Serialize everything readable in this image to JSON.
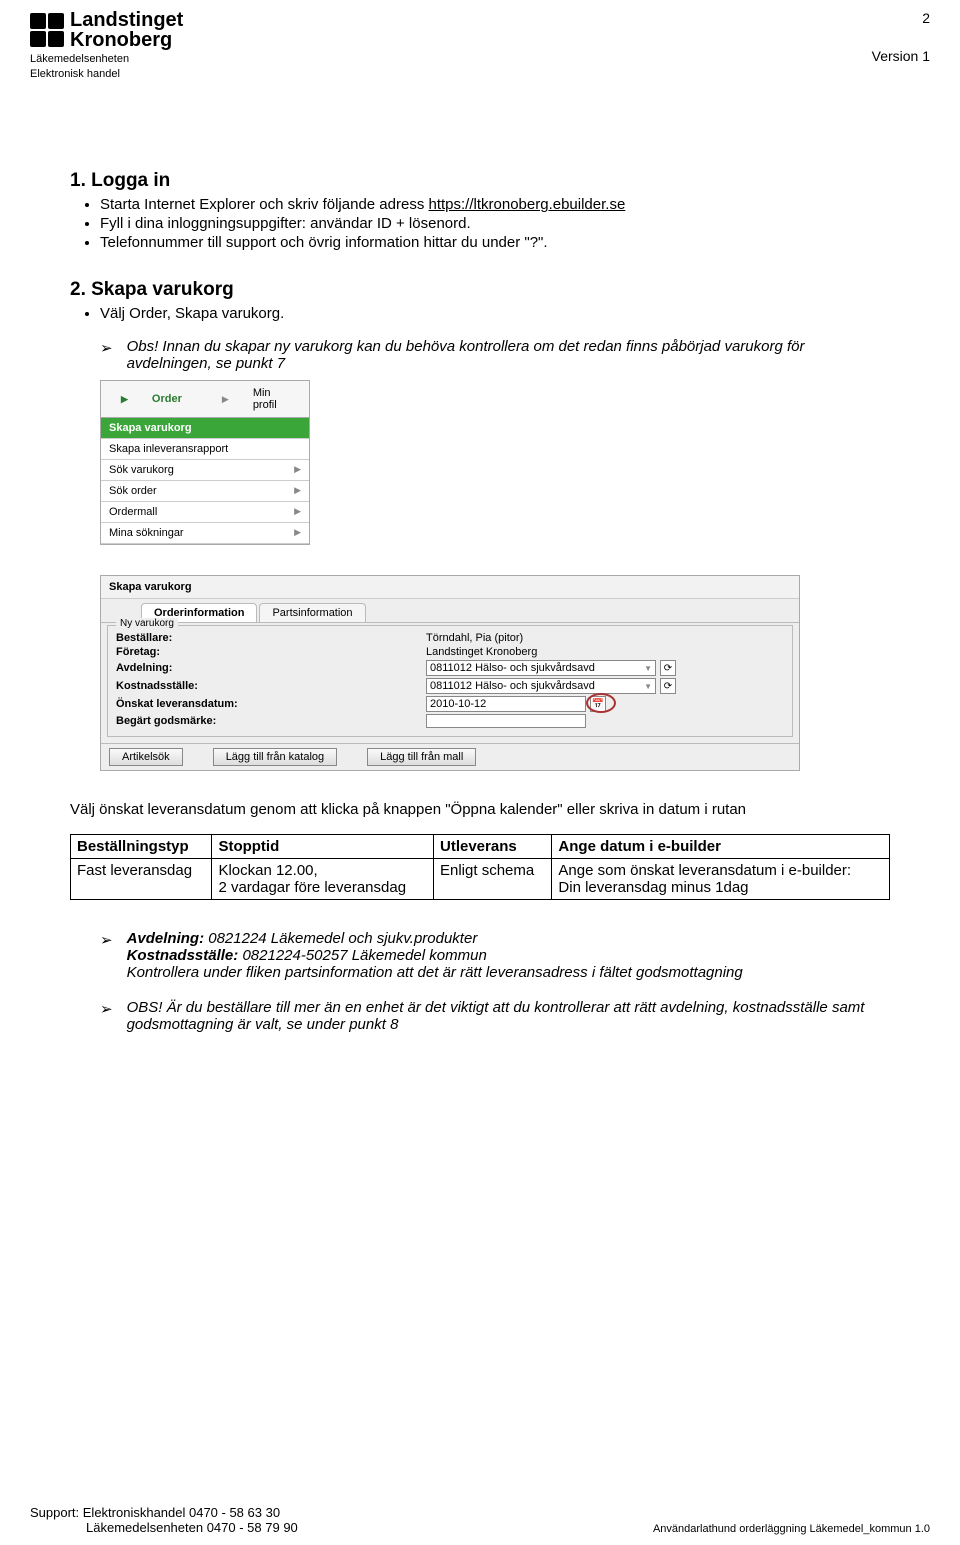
{
  "header": {
    "logo_line1": "Landstinget",
    "logo_line2": "Kronoberg",
    "sub1": "Läkemedelsenheten",
    "sub2": "Elektronisk handel",
    "page_number": "2",
    "version": "Version 1"
  },
  "section1": {
    "title": "1.   Logga in",
    "bullets": [
      {
        "pre": "Starta Internet Explorer och skriv följande adress ",
        "link": "https://ltkronoberg.ebuilder.se",
        "post": ""
      },
      {
        "pre": "Fyll i dina inloggningsuppgifter: användar ID + lösenord.",
        "link": "",
        "post": ""
      },
      {
        "pre": "Telefonnummer till support och övrig information hittar du under \"?\".",
        "link": "",
        "post": ""
      }
    ]
  },
  "section2": {
    "title": "2.   Skapa varukorg",
    "bullets": [
      {
        "pre": "Välj Order, Skapa varukorg.",
        "link": "",
        "post": ""
      }
    ],
    "note": "Obs! Innan du skapar ny varukorg kan du behöva kontrollera om det redan finns påbörjad varukorg för avdelningen, se punkt 7"
  },
  "ss_menu": {
    "top_active": "Order",
    "top_other": "Min profil",
    "items": [
      {
        "label": "Skapa varukorg",
        "green": true,
        "chev": false
      },
      {
        "label": "Skapa inleveransrapport",
        "green": false,
        "chev": false
      },
      {
        "label": "Sök varukorg",
        "green": false,
        "chev": true
      },
      {
        "label": "Sök order",
        "green": false,
        "chev": true
      },
      {
        "label": "Ordermall",
        "green": false,
        "chev": true
      },
      {
        "label": "Mina sökningar",
        "green": false,
        "chev": true
      }
    ]
  },
  "ss_form": {
    "title": "Skapa varukorg",
    "tab1": "Orderinformation",
    "tab2": "Partsinformation",
    "legend": "Ny varukorg",
    "labels": {
      "bestallare": "Beställare:",
      "foretag": "Företag:",
      "avdelning": "Avdelning:",
      "kostnad": "Kostnadsställe:",
      "levdatum": "Önskat leveransdatum:",
      "godsmarke": "Begärt godsmärke:"
    },
    "values": {
      "bestallare": "Törndahl, Pia (pitor)",
      "foretag": "Landstinget Kronoberg",
      "avdelning": "0811012 Hälso- och sjukvårdsavd",
      "kostnad": "0811012 Hälso- och sjukvårdsavd",
      "levdatum": "2010-10-12",
      "godsmarke": ""
    },
    "buttons": {
      "b1": "Artikelsök",
      "b2": "Lägg till från katalog",
      "b3": "Lägg till från mall"
    }
  },
  "para_after_form": "Välj önskat leveransdatum genom att klicka på knappen \"Öppna kalender\" eller skriva in datum i rutan",
  "table": {
    "headers": [
      "Beställningstyp",
      "Stopptid",
      "Utleverans",
      "Ange datum i e-builder"
    ],
    "rows": [
      {
        "c0": "Fast leveransdag",
        "c1": "Klockan 12.00,\n2 vardagar före leveransdag",
        "c2": "Enligt schema",
        "c3": "Ange som önskat leveransdatum i e-builder:\nDin leveransdag minus 1dag"
      }
    ]
  },
  "notes2": {
    "a_bold1": "Avdelning:",
    "a_plain1": " 0821224 Läkemedel och sjukv.produkter",
    "a_bold2": "Kostnadsställe:",
    "a_plain2": " 0821224-50257 Läkemedel kommun",
    "a_line3": "Kontrollera under fliken partsinformation att det är rätt leveransadress i fältet godsmottagning",
    "b": "OBS! Är du beställare till mer än en enhet är det viktigt att du kontrollerar att rätt avdelning, kostnadsställe samt godsmottagning är valt, se under punkt 8"
  },
  "footer": {
    "left1": "Support: Elektroniskhandel  0470 - 58 63 30",
    "left2": "Läkemedelsenheten  0470 - 58 79 90",
    "right": "Användarlathund orderläggning Läkemedel_kommun 1.0"
  }
}
